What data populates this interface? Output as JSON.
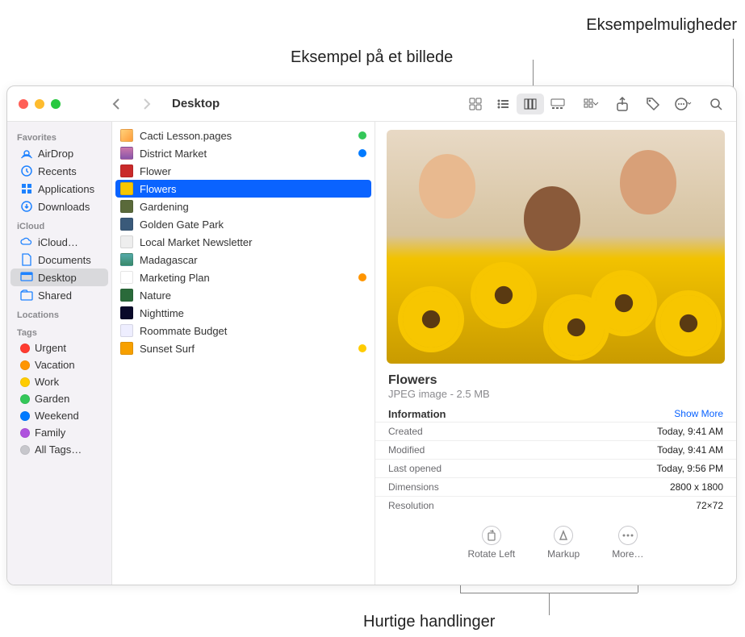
{
  "callouts": {
    "top_right": "Eksempelmuligheder",
    "top_center": "Eksempel på et billede",
    "bottom": "Hurtige handlinger"
  },
  "window": {
    "title": "Desktop"
  },
  "sidebar": {
    "sections": [
      {
        "header": "Favorites",
        "items": [
          {
            "icon": "airdrop",
            "label": "AirDrop"
          },
          {
            "icon": "clock",
            "label": "Recents"
          },
          {
            "icon": "apps",
            "label": "Applications"
          },
          {
            "icon": "download",
            "label": "Downloads"
          }
        ]
      },
      {
        "header": "iCloud",
        "items": [
          {
            "icon": "cloud",
            "label": "iCloud…"
          },
          {
            "icon": "doc",
            "label": "Documents"
          },
          {
            "icon": "desktop",
            "label": "Desktop",
            "selected": true
          },
          {
            "icon": "shared",
            "label": "Shared"
          }
        ]
      },
      {
        "header": "Locations",
        "items": []
      },
      {
        "header": "Tags",
        "items": [
          {
            "tag": "#ff3b30",
            "label": "Urgent"
          },
          {
            "tag": "#ff9500",
            "label": "Vacation"
          },
          {
            "tag": "#ffcc00",
            "label": "Work"
          },
          {
            "tag": "#34c759",
            "label": "Garden"
          },
          {
            "tag": "#007aff",
            "label": "Weekend"
          },
          {
            "tag": "#af52de",
            "label": "Family"
          },
          {
            "tag": "#c7c7cc",
            "label": "All Tags…"
          }
        ]
      }
    ]
  },
  "files": [
    {
      "label": "Cacti Lesson.pages",
      "c": "linear-gradient(135deg,#ffd27a,#ff9c3a)",
      "tag": "#34c759"
    },
    {
      "label": "District Market",
      "c": "linear-gradient(#c7a,#85a)",
      "tag": "#007aff"
    },
    {
      "label": "Flower",
      "c": "#c92a2a"
    },
    {
      "label": "Flowers",
      "c": "#f7c600",
      "selected": true
    },
    {
      "label": "Gardening",
      "c": "#5a6a3a"
    },
    {
      "label": "Golden Gate Park",
      "c": "#3a5a7a"
    },
    {
      "label": "Local Market Newsletter",
      "c": "#eee"
    },
    {
      "label": "Madagascar",
      "c": "linear-gradient(#5aa,#3a8a6a)"
    },
    {
      "label": "Marketing Plan",
      "c": "#fff",
      "tag": "#ff9500"
    },
    {
      "label": "Nature",
      "c": "#2a6a3a"
    },
    {
      "label": "Nighttime",
      "c": "#0a0a2a"
    },
    {
      "label": "Roommate Budget",
      "c": "#eef"
    },
    {
      "label": "Sunset Surf",
      "c": "#f7a000",
      "tag": "#ffcc00"
    }
  ],
  "preview": {
    "title": "Flowers",
    "subtitle": "JPEG image - 2.5 MB",
    "info_header": "Information",
    "show_more": "Show More",
    "rows": [
      {
        "k": "Created",
        "v": "Today, 9:41 AM"
      },
      {
        "k": "Modified",
        "v": "Today, 9:41 AM"
      },
      {
        "k": "Last opened",
        "v": "Today, 9:56 PM"
      },
      {
        "k": "Dimensions",
        "v": "2800 x 1800"
      },
      {
        "k": "Resolution",
        "v": "72×72"
      }
    ],
    "actions": [
      {
        "label": "Rotate Left",
        "icon": "rotate"
      },
      {
        "label": "Markup",
        "icon": "markup"
      },
      {
        "label": "More…",
        "icon": "more"
      }
    ]
  }
}
